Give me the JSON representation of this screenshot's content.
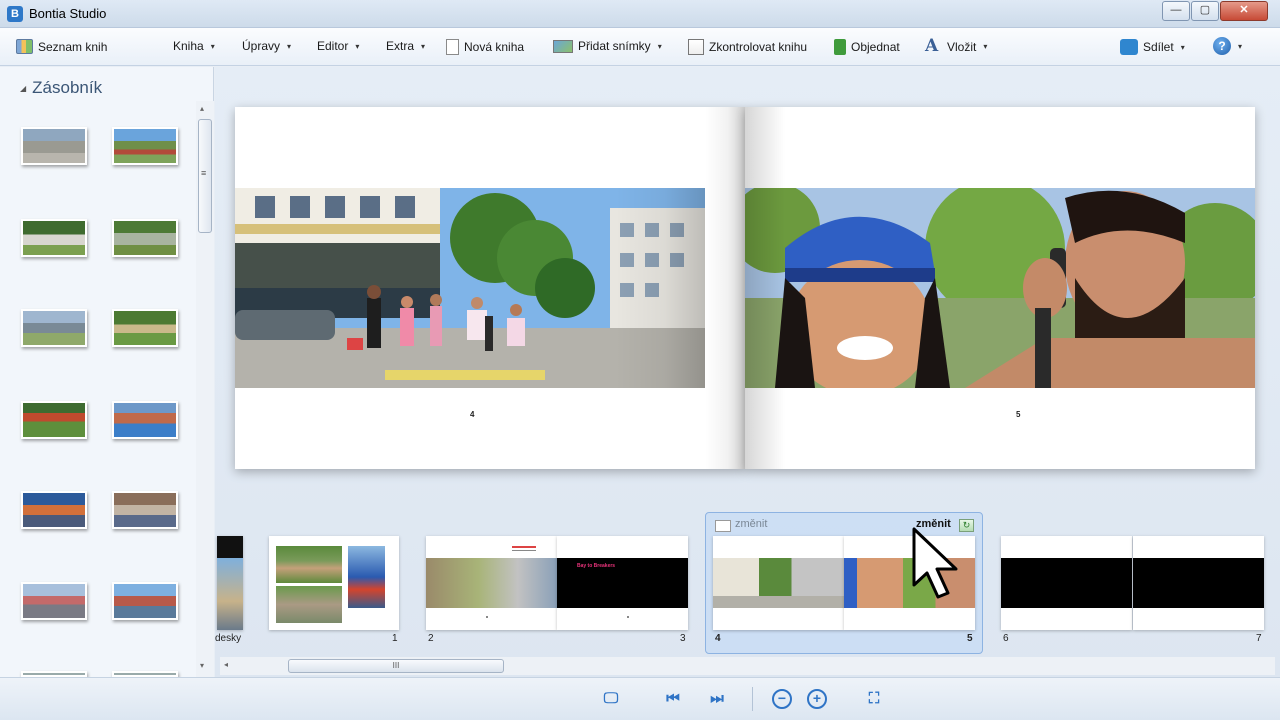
{
  "window": {
    "title": "Bontia Studio",
    "icon_letter": "B",
    "minimize": "—",
    "maximize": "▢",
    "close": "✕"
  },
  "toolbar": {
    "items": [
      {
        "label": "Seznam knih",
        "icon": "book-list-icon"
      },
      {
        "label": "Kniha",
        "dropdown": true
      },
      {
        "label": "Úpravy",
        "dropdown": true
      },
      {
        "label": "Editor",
        "dropdown": true
      },
      {
        "label": "Extra",
        "dropdown": true
      },
      {
        "label": "Nová kniha",
        "icon": "new-book-icon"
      },
      {
        "label": "Přidat snímky",
        "icon": "add-photos-icon",
        "dropdown": true
      },
      {
        "label": "Zkontrolovat knihu",
        "icon": "check-book-icon"
      },
      {
        "label": "Objednat",
        "icon": "order-icon"
      },
      {
        "label": "Vložit",
        "icon": "insert-text-icon",
        "dropdown": true
      },
      {
        "label": "Sdílet",
        "icon": "share-icon",
        "dropdown": true
      }
    ],
    "help": "?",
    "caret": "▾"
  },
  "sidebar": {
    "title": "Zásobník",
    "collapse_glyph": "◢"
  },
  "spread": {
    "left_page_number": "4",
    "right_page_number": "5"
  },
  "filmstrip": {
    "cover_label": "desky",
    "pages": [
      "1",
      "2",
      "3",
      "4",
      "5",
      "6",
      "7"
    ],
    "selected_label_left": "změnit",
    "selected_label_right": "změnit",
    "refresh_glyph": "↻",
    "pink_text": "Bay to Breakers"
  },
  "scroll": {
    "grip": "III",
    "left_arrow": "◂",
    "right_arrow": "▸",
    "up_arrow": "▴",
    "down_arrow": "▾",
    "sb_grip": "≡"
  },
  "bottombar": {
    "slideshow": "🖵",
    "first": "⏮",
    "last": "⏭",
    "zoom_out": "−",
    "zoom_in": "+",
    "fit": "⛶"
  },
  "colors": {
    "accent": "#2f74c6",
    "selection": "#bed7f5",
    "sidebar_bg": "#f2f6fb"
  }
}
